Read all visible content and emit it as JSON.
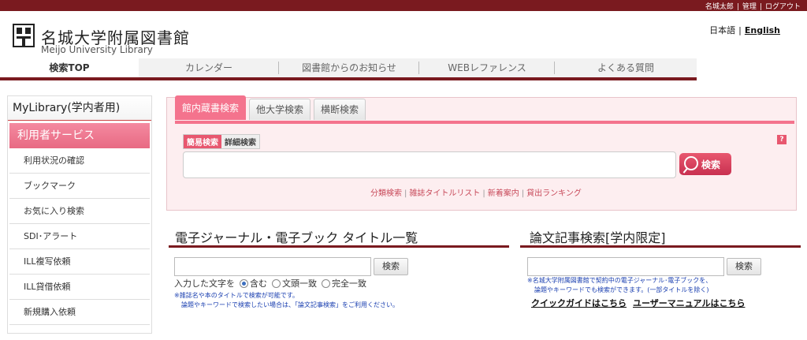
{
  "topbar": {
    "user": "名城太郎",
    "admin": "管理",
    "logout": "ログアウト",
    "sep": "|"
  },
  "logo": {
    "title": "名城大学附属図書館",
    "subtitle": "Meijo University Library"
  },
  "lang": {
    "ja": "日本語",
    "sep": "|",
    "en": "English"
  },
  "nav": [
    {
      "label": "検索TOP"
    },
    {
      "label": "カレンダー"
    },
    {
      "label": "図書館からのお知らせ"
    },
    {
      "label": "WEBレファレンス"
    },
    {
      "label": "よくある質問"
    }
  ],
  "sidebar": {
    "heading": "MyLibrary(学内者用)",
    "service": "利用者サービス",
    "items": [
      {
        "label": "利用状況の確認"
      },
      {
        "label": "ブックマーク"
      },
      {
        "label": "お気に入り検索"
      },
      {
        "label": "SDI･アラート"
      },
      {
        "label": "ILL複写依頼"
      },
      {
        "label": "ILL貸借依頼"
      },
      {
        "label": "新規購入依頼"
      }
    ]
  },
  "search": {
    "tabs": [
      {
        "label": "館内蔵書検索"
      },
      {
        "label": "他大学検索"
      },
      {
        "label": "横断検索"
      }
    ],
    "subtabs": [
      {
        "label": "簡易検索"
      },
      {
        "label": "詳細検索"
      }
    ],
    "help": "?",
    "input_value": "",
    "button": "検索",
    "links": [
      {
        "label": "分類検索"
      },
      {
        "label": "雑誌タイトルリスト"
      },
      {
        "label": "新着案内"
      },
      {
        "label": "貸出ランキング"
      }
    ],
    "link_sep": "|"
  },
  "ejournal": {
    "title": "電子ジャーナル・電子ブック タイトル一覧",
    "button": "検索",
    "radio_prefix": "入力した文字を",
    "options": [
      {
        "label": "含む",
        "selected": true
      },
      {
        "label": "文頭一致"
      },
      {
        "label": "完全一致"
      }
    ],
    "note1": "※雑誌名や本のタイトルで検索が可能です。",
    "note2": "論題やキーワードで検索したい場合は、「論文記事検索」をご利用ください。"
  },
  "article": {
    "title": "論文記事検索[学内限定]",
    "button": "検索",
    "note1": "※名城大学附属図書館で契約中の電子ジャーナル･電子ブックを、",
    "note2": "論題やキーワードでも検索ができます。(一部タイトルを除く)",
    "guide1": "クイックガイドはこちら",
    "guide2": "ユーザーマニュアルはこちら"
  }
}
